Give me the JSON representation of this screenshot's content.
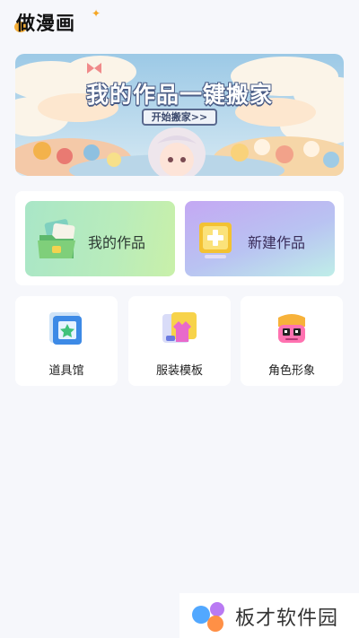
{
  "app": {
    "title": "做漫画"
  },
  "banner": {
    "title": "我的作品一键搬家",
    "button_label": "开始搬家>>"
  },
  "features": [
    {
      "label": "我的作品",
      "icon": "folder-icon"
    },
    {
      "label": "新建作品",
      "icon": "plus-icon"
    }
  ],
  "tools": [
    {
      "label": "道具馆",
      "icon": "prop-icon"
    },
    {
      "label": "服装模板",
      "icon": "clothing-icon"
    },
    {
      "label": "角色形象",
      "icon": "character-icon"
    }
  ],
  "watermark": {
    "text": "板才软件园"
  },
  "colors": {
    "accent": "#f5a623",
    "background": "#f6f7fb"
  }
}
